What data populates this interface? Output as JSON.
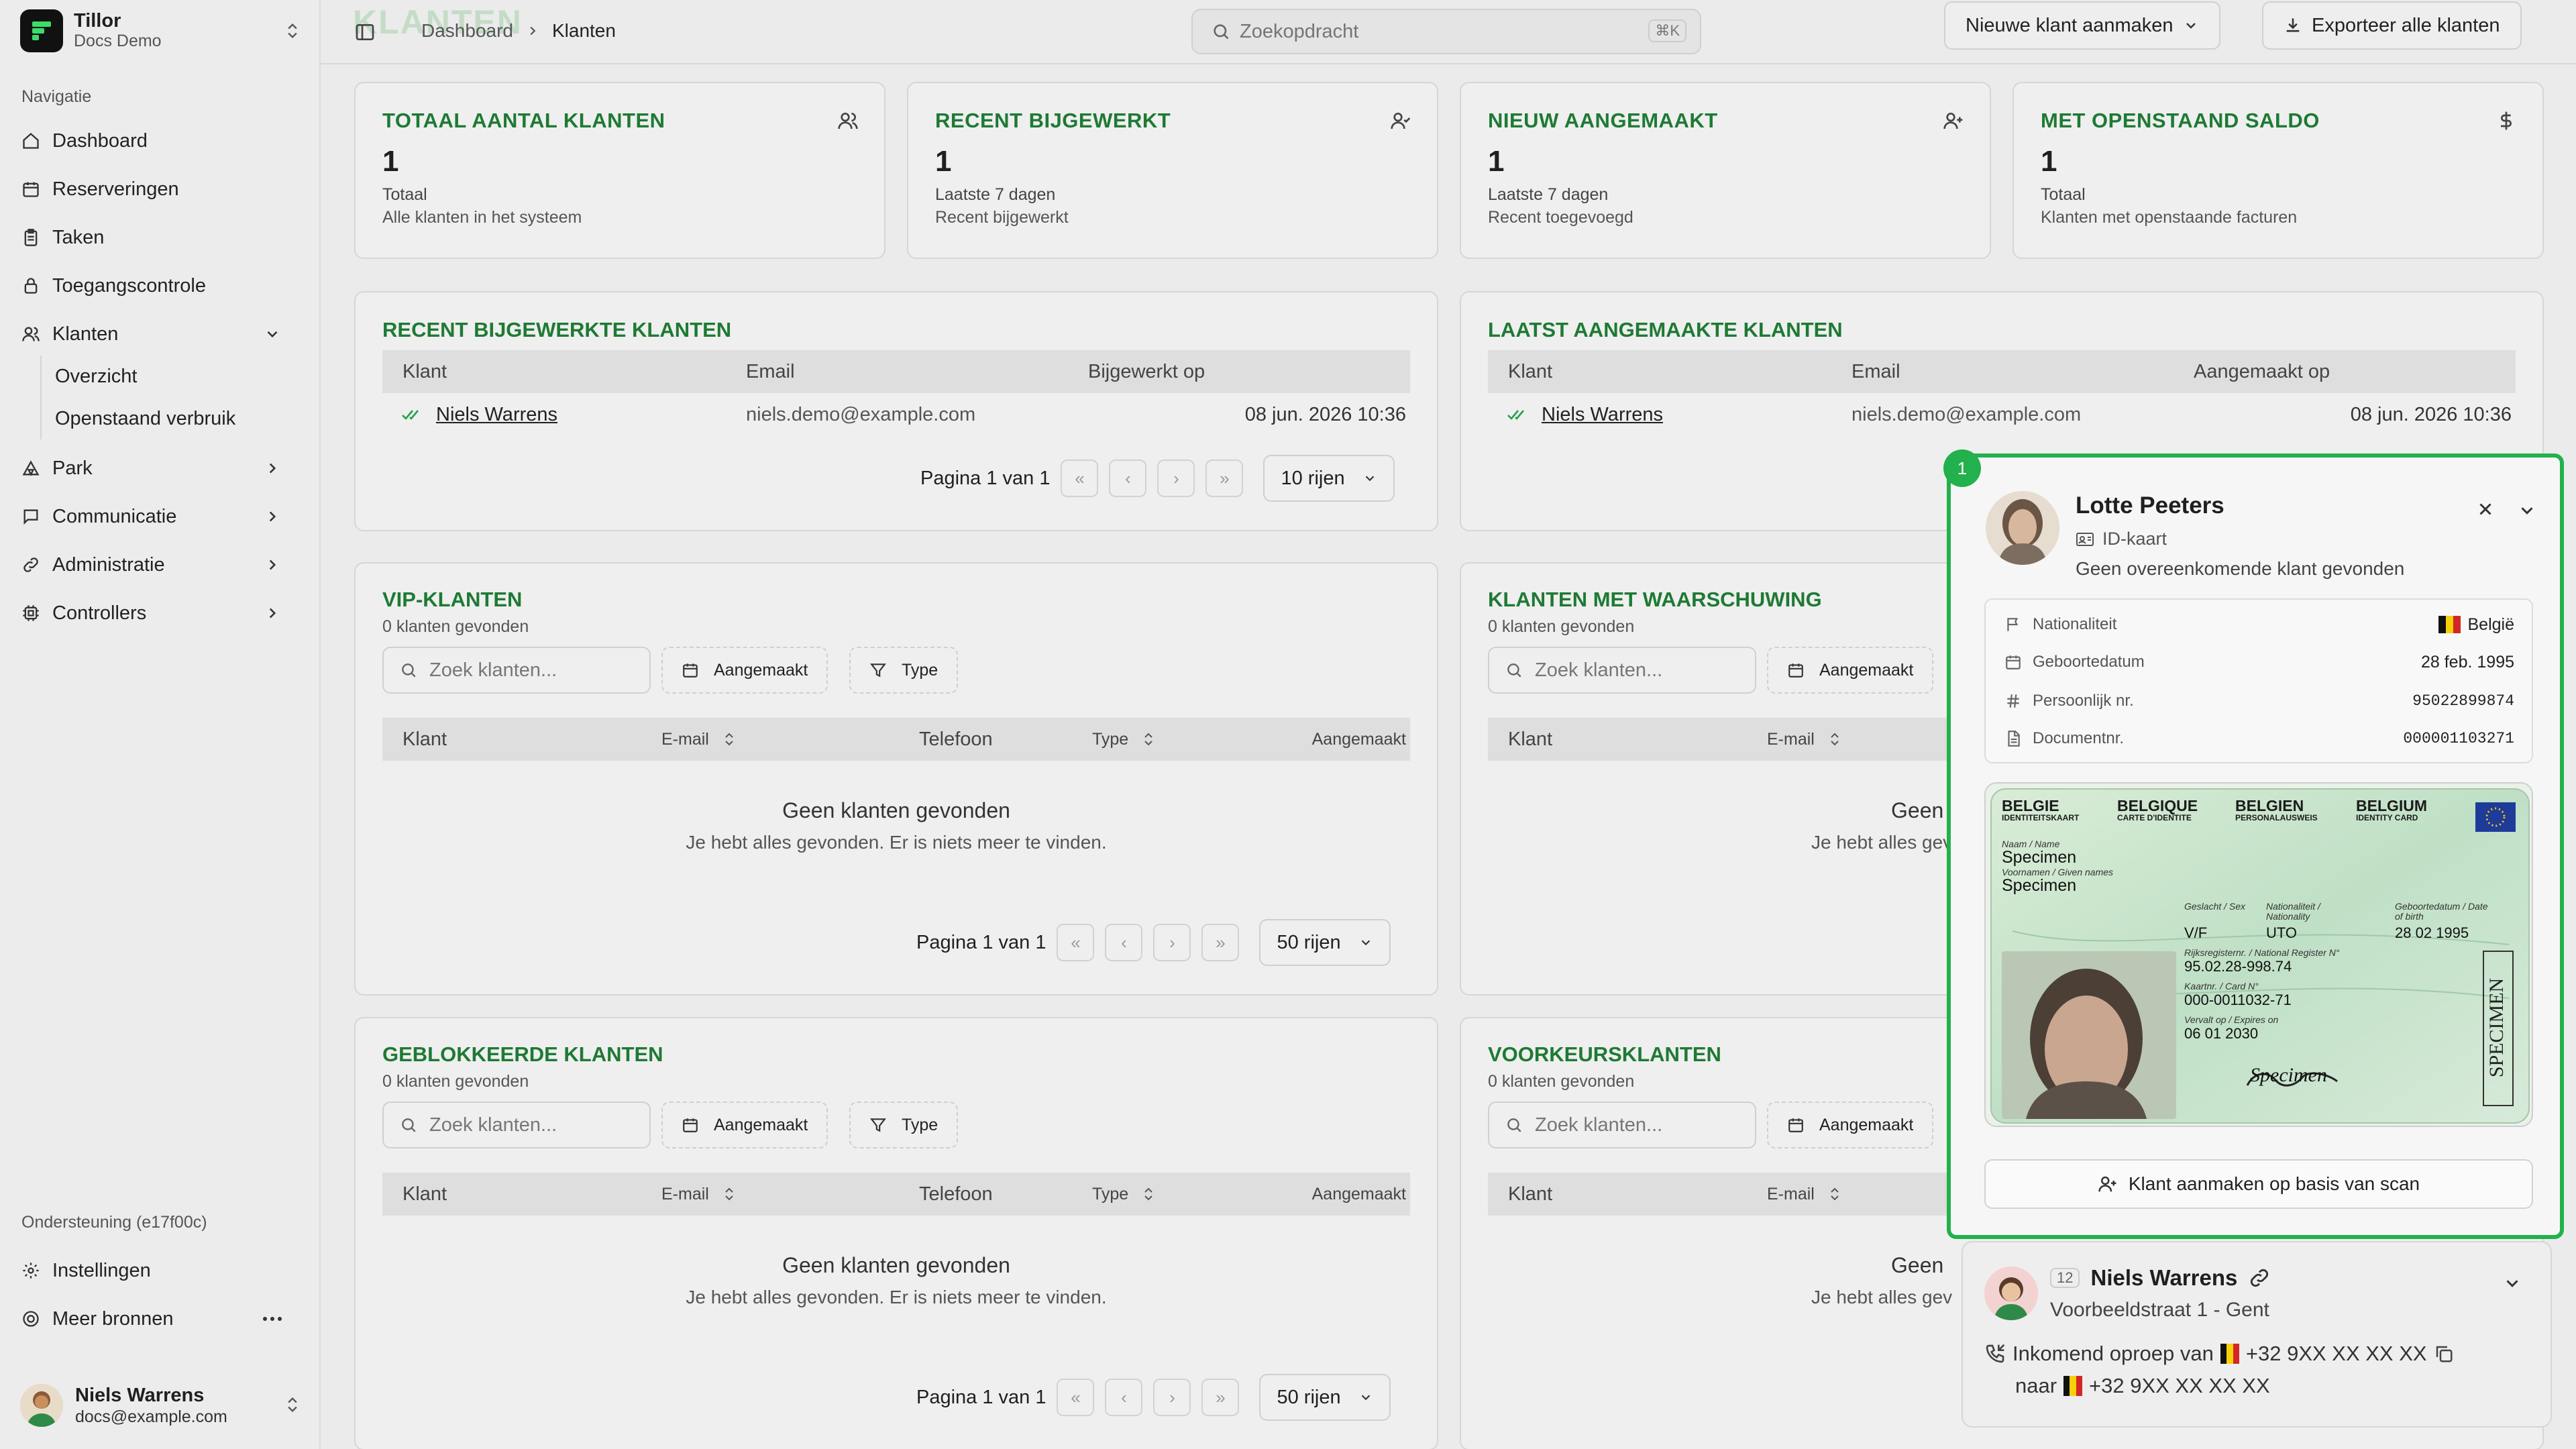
{
  "org": {
    "name": "Tillor",
    "sub": "Docs Demo"
  },
  "sidebar": {
    "section_label": "Navigatie",
    "items": [
      {
        "label": "Dashboard"
      },
      {
        "label": "Reserveringen"
      },
      {
        "label": "Taken"
      },
      {
        "label": "Toegangscontrole"
      },
      {
        "label": "Klanten"
      },
      {
        "label": "Park"
      },
      {
        "label": "Communicatie"
      },
      {
        "label": "Administratie"
      },
      {
        "label": "Controllers"
      }
    ],
    "sub_items": [
      {
        "label": "Overzicht"
      },
      {
        "label": "Openstaand verbruik"
      }
    ],
    "support_label": "Ondersteuning (e17f00c)",
    "settings": "Instellingen",
    "more": "Meer bronnen",
    "user": {
      "name": "Niels Warrens",
      "email": "docs@example.com"
    }
  },
  "header": {
    "ghost_title": "KLANTEN",
    "breadcrumb": [
      "Dashboard",
      "Klanten"
    ],
    "search_placeholder": "Zoekopdracht",
    "search_kbd": "⌘K",
    "new_button": "Nieuwe klant aanmaken",
    "export_button": "Exporteer alle klanten"
  },
  "stats": [
    {
      "title": "TOTAAL AANTAL KLANTEN",
      "value": "1",
      "l1": "Totaal",
      "l2": "Alle klanten in het systeem",
      "icon": "users-icon"
    },
    {
      "title": "RECENT BIJGEWERKT",
      "value": "1",
      "l1": "Laatste 7 dagen",
      "l2": "Recent bijgewerkt",
      "icon": "user-check-icon"
    },
    {
      "title": "NIEUW AANGEMAAKT",
      "value": "1",
      "l1": "Laatste 7 dagen",
      "l2": "Recent toegevoegd",
      "icon": "user-plus-icon"
    },
    {
      "title": "MET OPENSTAAND SALDO",
      "value": "1",
      "l1": "Totaal",
      "l2": "Klanten met openstaande facturen",
      "icon": "dollar-icon"
    }
  ],
  "recent_updated": {
    "title": "RECENT BIJGEWERKTE KLANTEN",
    "cols": [
      "Klant",
      "Email",
      "Bijgewerkt op"
    ],
    "rows": [
      {
        "name": "Niels Warrens",
        "email": "niels.demo@example.com",
        "date": "08 jun. 2026 10:36"
      }
    ],
    "page": "Pagina 1 van 1",
    "rows_label": "10 rijen"
  },
  "recent_created": {
    "title": "LAATST AANGEMAAKTE KLANTEN",
    "cols": [
      "Klant",
      "Email",
      "Aangemaakt op"
    ],
    "rows": [
      {
        "name": "Niels Warrens",
        "email": "niels.demo@example.com",
        "date": "08 jun. 2026 10:36"
      }
    ]
  },
  "list_cols": [
    "Klant",
    "E-mail",
    "Telefoon",
    "Type",
    "Aangemaakt"
  ],
  "filters": {
    "search_placeholder": "Zoek klanten...",
    "created": "Aangemaakt",
    "type": "Type"
  },
  "empty": {
    "title": "Geen klanten gevonden",
    "sub": "Je hebt alles gevonden. Er is niets meer te vinden.",
    "title_short": "Geen",
    "sub_short": "Je hebt alles gev"
  },
  "vip": {
    "title": "VIP-KLANTEN",
    "count": "0 klanten gevonden",
    "page": "Pagina 1 van 1",
    "rows_label": "50 rijen"
  },
  "warning": {
    "title": "KLANTEN MET WAARSCHUWING",
    "count": "0 klanten gevonden"
  },
  "blocked": {
    "title": "GEBLOKKEERDE KLANTEN",
    "count": "0 klanten gevonden",
    "page": "Pagina 1 van 1",
    "rows_label": "50 rijen"
  },
  "preferred": {
    "title": "VOORKEURSKLANTEN",
    "count": "0 klanten gevonden"
  },
  "scan_popup": {
    "badge": "1",
    "name": "Lotte Peeters",
    "doc_type": "ID-kaart",
    "status": "Geen overeenkomende klant gevonden",
    "fields": [
      {
        "label": "Nationaliteit",
        "value": "België"
      },
      {
        "label": "Geboortedatum",
        "value": "28 feb. 1995"
      },
      {
        "label": "Persoonlijk nr.",
        "value": "95022899874"
      },
      {
        "label": "Documentnr.",
        "value": "000001103271"
      }
    ],
    "card": {
      "h1": "BELGIE",
      "h1s": "IDENTITEITSKAART",
      "h2": "BELGIQUE",
      "h2s": "CARTE D'IDENTITE",
      "h3": "BELGIEN",
      "h3s": "PERSONALAUSWEIS",
      "h4": "BELGIUM",
      "h4s": "IDENTITY CARD",
      "name_label": "Naam / Name",
      "name": "Specimen",
      "given_label": "Voornamen / Given names",
      "given": "Specimen",
      "sex_label": "Geslacht / Sex",
      "sex": "V/F",
      "nat_label": "Nationaliteit / Nationality",
      "nat": "UTO",
      "dob_label": "Geboortedatum / Date of birth",
      "dob": "28 02 1995",
      "reg_label": "Rijksregisternr. / National Register N°",
      "reg": "95.02.28-998.74",
      "card_label": "Kaartnr. / Card N°",
      "card_no": "000-0011032-71",
      "exp_label": "Vervalt op / Expires on",
      "exp": "06 01 2030",
      "specimen": "SPECIMEN",
      "signature": "Specimen"
    },
    "button": "Klant aanmaken op basis van scan"
  },
  "call": {
    "badge": "12",
    "name": "Niels Warrens",
    "address": "Voorbeeldstraat 1 - Gent",
    "line1_prefix": "Inkomend oproep van",
    "from": "+32 9XX XX XX XX",
    "line2_prefix": "naar",
    "to": "+32 9XX XX XX XX"
  },
  "colors": {
    "accent": "#1e7a34",
    "highlight": "#22b14c"
  }
}
